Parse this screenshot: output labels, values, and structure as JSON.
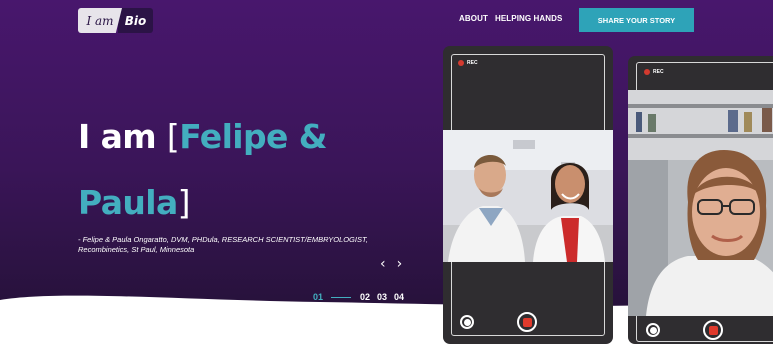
{
  "brand": {
    "logo_left": "I am",
    "logo_right": "Bio"
  },
  "nav": {
    "items": [
      "ABOUT",
      "HELPING HANDS"
    ],
    "cta_label": "SHARE YOUR STORY"
  },
  "hero": {
    "prefix": "I am ",
    "bracket_open": "[",
    "name_line1": "Felipe &",
    "name_line2": "Paula",
    "bracket_close": "]",
    "attribution_line1": "- Felipe & Paula Ongaratto, DVM, PHDula, RESEARCH SCIENTIST/EMBRYOLOGIST,",
    "attribution_line2": "Recombinetics, St Paul, Minnesota"
  },
  "carousel": {
    "prev": "‹",
    "next": "›",
    "pages": [
      "01",
      "02",
      "03",
      "04"
    ],
    "active_index": 0
  },
  "phones": [
    {
      "rec_label": "REC"
    },
    {
      "rec_label": "REC"
    }
  ],
  "colors": {
    "accent": "#2ea3b8",
    "headline_accent": "#43aebf",
    "bg_dark": "#2b1346",
    "bg_mid": "#4a1c6e"
  }
}
